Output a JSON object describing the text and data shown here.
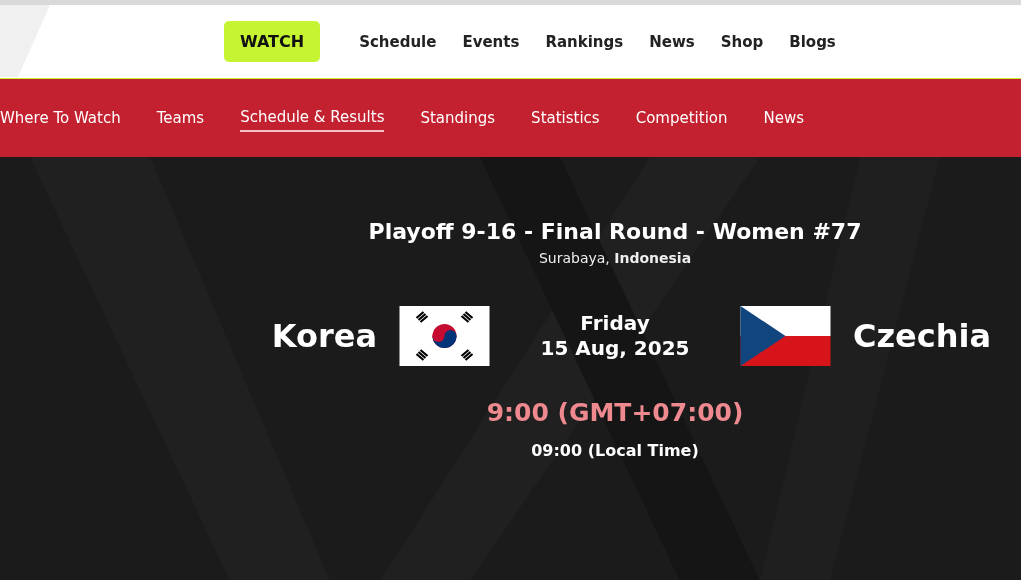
{
  "main_nav": [
    {
      "label": "WATCH",
      "kind": "button"
    },
    {
      "label": "Schedule",
      "kind": "link"
    },
    {
      "label": "Events",
      "kind": "link"
    },
    {
      "label": "Rankings",
      "kind": "link"
    },
    {
      "label": "News",
      "kind": "link"
    },
    {
      "label": "Shop",
      "kind": "link"
    },
    {
      "label": "Blogs",
      "kind": "link"
    }
  ],
  "sub_nav": [
    {
      "label": "Where To Watch",
      "selected": false
    },
    {
      "label": "Teams",
      "selected": false
    },
    {
      "label": "Schedule & Results",
      "selected": true
    },
    {
      "label": "Standings",
      "selected": false
    },
    {
      "label": "Statistics",
      "selected": false
    },
    {
      "label": "Competition",
      "selected": false
    },
    {
      "label": "News",
      "selected": false
    }
  ],
  "match": {
    "title": "Playoff 9-16 - Final Round - Women #77",
    "location": "Surabaya, **Indonesia**",
    "home": {
      "name": "Korea",
      "kind": "korea"
    },
    "away": {
      "name": "Czechia",
      "kind": "czechia"
    },
    "day": "Friday",
    "date": "15 Aug, 2025",
    "time": "9:00 (GMT+07:00)",
    "local_time": "09:00 (Local Time)"
  }
}
